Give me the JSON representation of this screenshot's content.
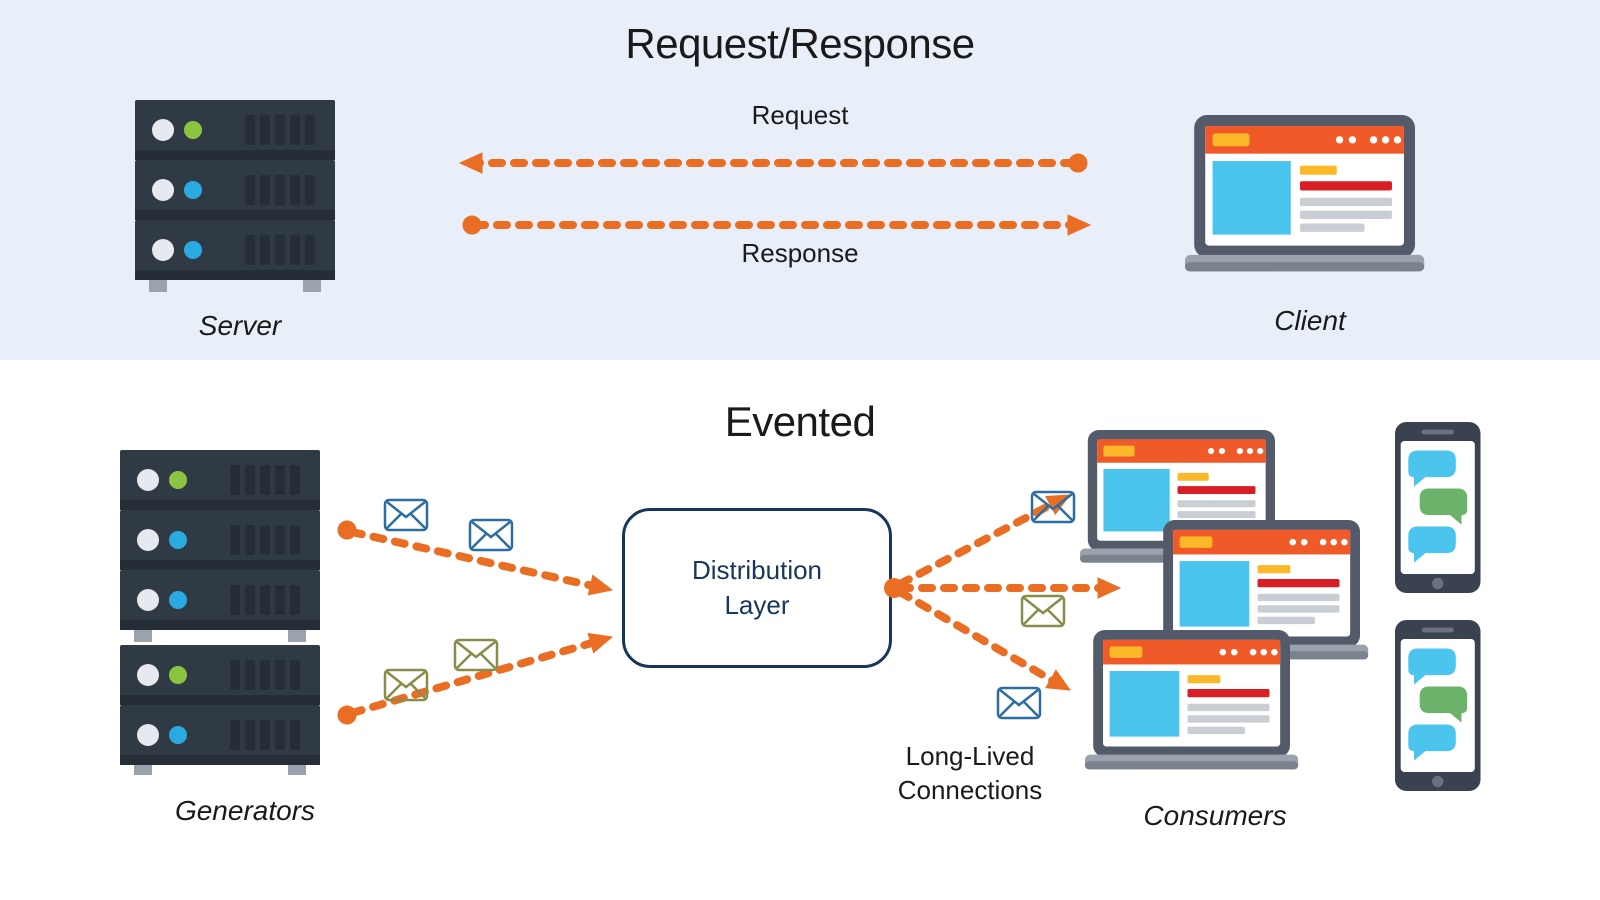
{
  "top": {
    "title": "Request/Response",
    "request_label": "Request",
    "response_label": "Response",
    "server_label": "Server",
    "client_label": "Client"
  },
  "bottom": {
    "title": "Evented",
    "generators_label": "Generators",
    "consumers_label": "Consumers",
    "distribution_label": "Distribution\nLayer",
    "connections_label": "Long-Lived\nConnections"
  },
  "colors": {
    "orange": "#e96e24",
    "panel": "#e8eff8",
    "navy": "#17365a",
    "server_dark": "#2f3a45",
    "server_darker": "#252e37",
    "laptop_frame": "#535b6b",
    "laptop_header": "#f05a28",
    "yellow": "#fbb829",
    "cyan": "#4bc5ee",
    "red_bar": "#d81f26",
    "gray_bar": "#c9cdd4",
    "green_led": "#8bc53f",
    "blue_led": "#29abe2",
    "phone_body": "#3a424f",
    "bubble_blue": "#4bc5ee",
    "bubble_green": "#6bb36a",
    "env_blue": "#2c6ea0",
    "env_olive": "#8a8c4a"
  }
}
